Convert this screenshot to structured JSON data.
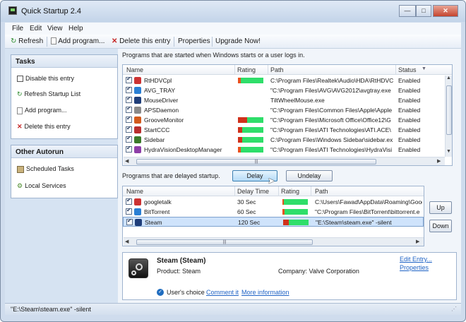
{
  "window": {
    "title": "Quick Startup 2.4",
    "buttons": [
      "minimize",
      "maximize",
      "close"
    ]
  },
  "menu": [
    "File",
    "Edit",
    "View",
    "Help"
  ],
  "toolbar": {
    "refresh": "Refresh",
    "add": "Add program...",
    "delete": "Delete this entry",
    "properties": "Properties",
    "upgrade": "Upgrade Now!"
  },
  "tasks": {
    "header": "Tasks",
    "items": [
      "Disable this entry",
      "Refresh Startup List",
      "Add program...",
      "Delete this entry"
    ]
  },
  "other": {
    "header": "Other Autorun",
    "items": [
      "Scheduled Tasks",
      "Local Services"
    ]
  },
  "startup": {
    "caption": "Programs that are started when Windows starts or a user logs in.",
    "columns": [
      "Name",
      "Rating",
      "Path",
      "Status"
    ],
    "rows": [
      {
        "name": "RtHDVCpl",
        "rating": 0.12,
        "path": "C:\\Program Files\\Realtek\\Audio\\HDA\\RtHDVC",
        "status": "Enabled"
      },
      {
        "name": "AVG_TRAY",
        "rating": null,
        "path": "\"C:\\Program Files\\AVG\\AVG2012\\avgtray.exe",
        "status": "Enabled"
      },
      {
        "name": "MouseDriver",
        "rating": null,
        "path": "TiltWheelMouse.exe",
        "status": "Enabled"
      },
      {
        "name": "APSDaemon",
        "rating": null,
        "path": "\"C:\\Program Files\\Common Files\\Apple\\Apple",
        "status": "Enabled"
      },
      {
        "name": "GrooveMonitor",
        "rating": 0.35,
        "path": "\"C:\\Program Files\\Microsoft Office\\Office12\\G",
        "status": "Enabled"
      },
      {
        "name": "StartCCC",
        "rating": 0.18,
        "path": "\"C:\\Program Files\\ATI Technologies\\ATI.ACE\\",
        "status": "Enabled"
      },
      {
        "name": "Sidebar",
        "rating": 0.18,
        "path": "C:\\Program Files\\Windows Sidebar\\sidebar.ex",
        "status": "Enabled"
      },
      {
        "name": "HydraVisionDesktopManager",
        "rating": 0.1,
        "path": "\"C:\\Program Files\\ATI Technologies\\HydraVisi",
        "status": "Enabled"
      }
    ]
  },
  "delayed": {
    "caption": "Programs that are delayed startup.",
    "delay_btn": "Delay",
    "undelay_btn": "Undelay",
    "columns": [
      "Name",
      "Delay Time",
      "Rating",
      "Path"
    ],
    "rows": [
      {
        "name": "googletalk",
        "delay": "30 Sec",
        "rating": 0,
        "path": "C:\\Users\\Fawad\\AppData\\Roaming\\Goog"
      },
      {
        "name": "BitTorrent",
        "delay": "60 Sec",
        "rating": 0.08,
        "path": "\"C:\\Program Files\\BitTorrent\\bittorrent.e"
      },
      {
        "name": "Steam",
        "delay": "120 Sec",
        "rating": 0.22,
        "path": "\"E:\\Steam\\steam.exe\" -silent"
      }
    ],
    "up": "Up",
    "down": "Down"
  },
  "details": {
    "title": "Steam (Steam)",
    "product": "Product: Steam",
    "company": "Company: Valve Corporation",
    "edit": "Edit Entry...",
    "properties": "Properties",
    "users_choice": "User's choice",
    "comment": "Comment it",
    "more": "More information"
  },
  "statusbar": {
    "text": "\"E:\\Steam\\steam.exe\" -silent"
  }
}
